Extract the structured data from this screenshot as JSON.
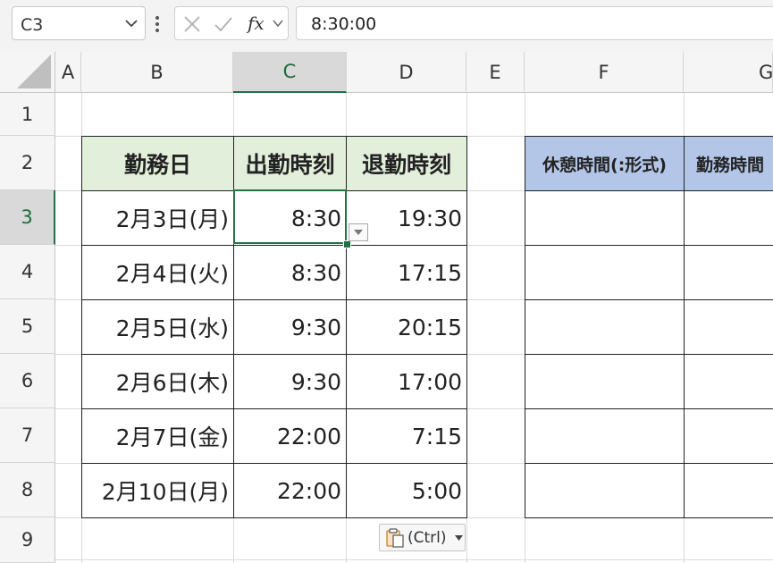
{
  "formula_bar": {
    "name_box": "C3",
    "cancel_icon": "x-icon",
    "enter_icon": "check-icon",
    "fx_label": "fx",
    "formula": "8:30:00"
  },
  "columns": [
    "A",
    "B",
    "C",
    "D",
    "E",
    "F",
    "G"
  ],
  "rows": [
    "1",
    "2",
    "3",
    "4",
    "5",
    "6",
    "7",
    "8",
    "9"
  ],
  "selected": {
    "column": "C",
    "row": "3"
  },
  "table": {
    "headers": [
      "勤務日",
      "出勤時刻",
      "退勤時刻"
    ],
    "rows": [
      [
        "2月3日(月)",
        "8:30",
        "19:30"
      ],
      [
        "2月4日(火)",
        "8:30",
        "17:15"
      ],
      [
        "2月5日(水)",
        "9:30",
        "20:15"
      ],
      [
        "2月6日(木)",
        "9:30",
        "17:00"
      ],
      [
        "2月7日(金)",
        "22:00",
        "7:15"
      ],
      [
        "2月10日(月)",
        "22:00",
        "5:00"
      ]
    ]
  },
  "table2": {
    "headers": [
      "休憩時間(:形式)",
      "勤務時間"
    ]
  },
  "paste_options": {
    "label": "(Ctrl)",
    "icon": "clipboard-icon"
  },
  "colors": {
    "header_green": "#e2efda",
    "header_blue": "#b4c6e7",
    "selection": "#217346"
  }
}
